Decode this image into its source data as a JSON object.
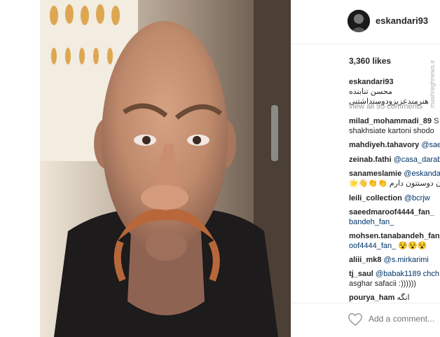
{
  "post": {
    "username": "eskandari93",
    "likes": "3,360 likes",
    "caption_user": "eskandari93",
    "caption_line1": "محسن تنابنده",
    "caption_line2": "هنرمندعزیزودوستداشتنی",
    "view_all": "view all 95 comments",
    "add_comment_placeholder": "Add a comment...",
    "watermark": "mashreghnews.ir"
  },
  "comments": [
    {
      "user": "milad_mohammadi_89",
      "text": "S",
      "line2": "shakhsiate kartoni shodo"
    },
    {
      "user": "mahdiyeh.tahavory",
      "text": "@saeedmaroo"
    },
    {
      "user": "zeinab.fathi",
      "text": "@casa_darab"
    },
    {
      "user": "sanameslamie",
      "text": "@eskanda",
      "line2": "برتوان دوستتون دارم 👏👏👋🌟"
    },
    {
      "user": "leili_collection",
      "text": "@bcrjw"
    },
    {
      "user": "saeedmaroof4444_fan_",
      "text": "",
      "line2": "bandeh_fan_"
    },
    {
      "user": "mohsen.tanabandeh_fan_",
      "text": "",
      "line2": "oof4444_fan_ 😵😵😵"
    },
    {
      "user": "aliii_mk8",
      "text": "@s.mirkarimi"
    },
    {
      "user": "tj_saul",
      "text": "@babak1189 chch",
      "line2": "asghar safacii :))))))"
    },
    {
      "user": "pourya_ham",
      "text": "انگه"
    }
  ],
  "colors": {
    "text": "#262626",
    "mention": "#003569",
    "muted": "#999999",
    "divider": "#efefef"
  },
  "icons": [
    "heart-icon",
    "avatar"
  ]
}
